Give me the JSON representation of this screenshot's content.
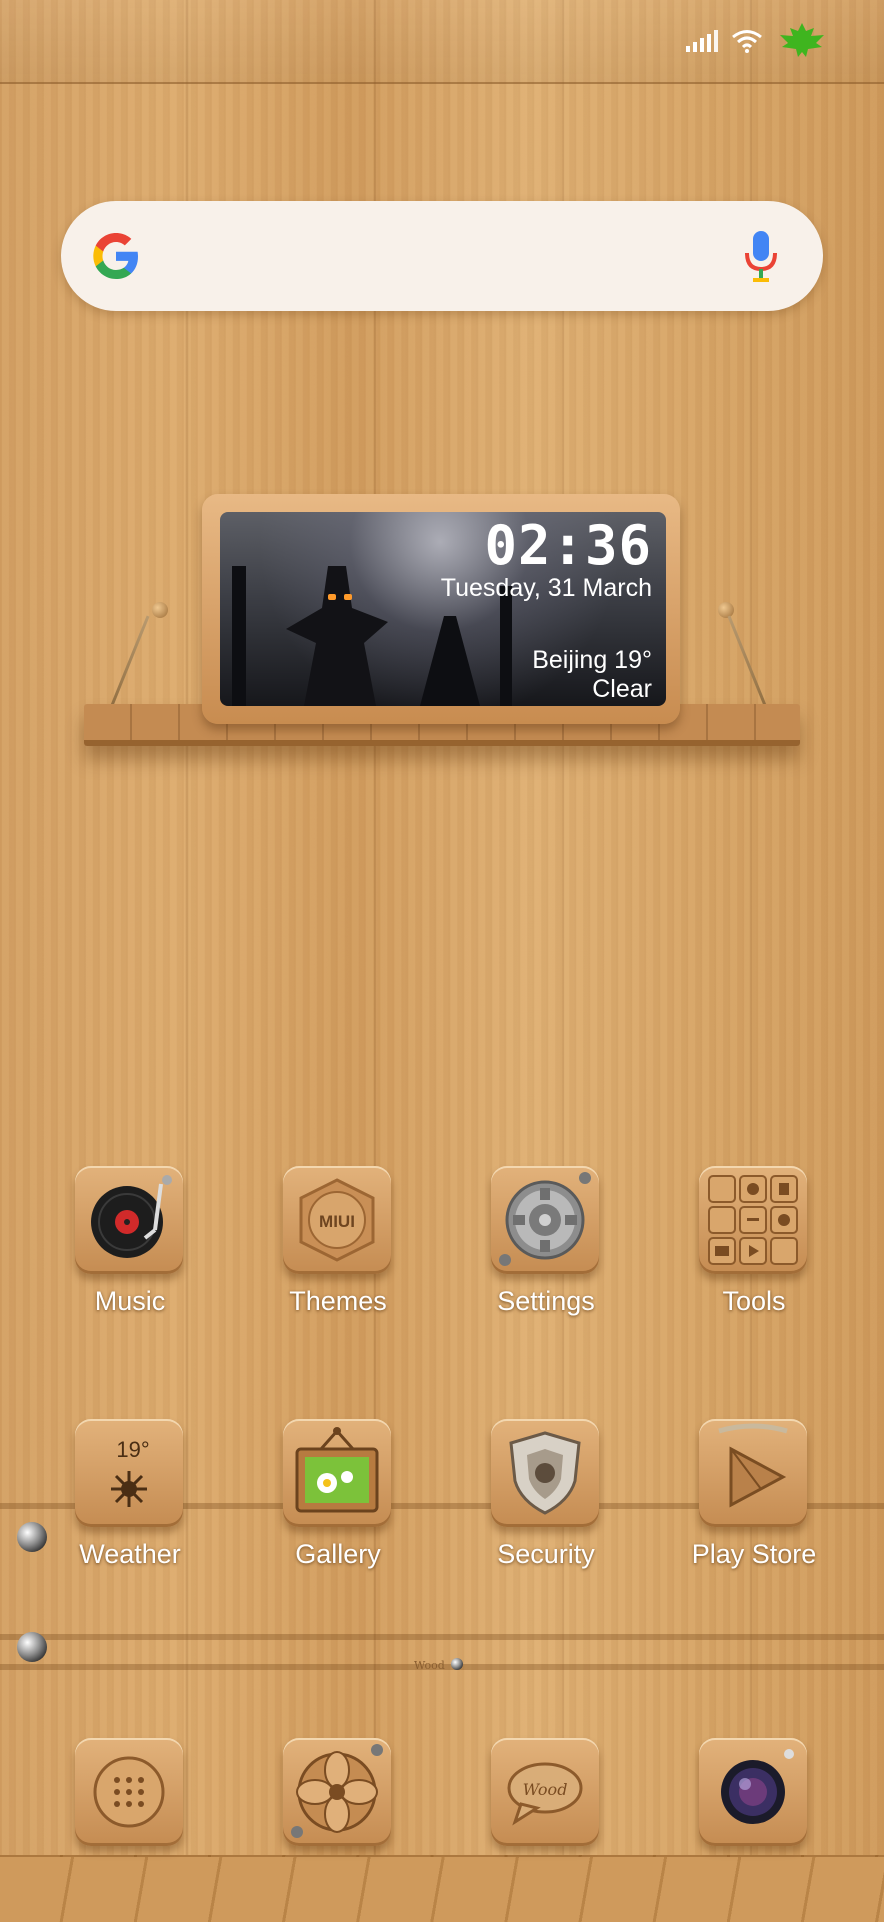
{
  "status_bar": {
    "icons": [
      "signal-icon",
      "wifi-icon",
      "leaf-battery-icon"
    ]
  },
  "search": {
    "logo": "google-g-icon",
    "mic": "mic-icon"
  },
  "widget": {
    "time": "02:36",
    "date": "Tuesday, 31 March",
    "city_temp": "Beijing  19°",
    "condition": "Clear"
  },
  "apps_row1": [
    {
      "label": "Music",
      "icon": "turntable-icon"
    },
    {
      "label": "Themes",
      "icon": "miui-badge-icon"
    },
    {
      "label": "Settings",
      "icon": "gear-icon"
    },
    {
      "label": "Tools",
      "icon": "tools-folder-icon"
    }
  ],
  "apps_row2": [
    {
      "label": "Weather",
      "icon": "sun-icon",
      "temp": "19°"
    },
    {
      "label": "Gallery",
      "icon": "picture-frame-icon"
    },
    {
      "label": "Security",
      "icon": "shield-icon"
    },
    {
      "label": "Play Store",
      "icon": "play-icon"
    }
  ],
  "tile_text": {
    "miui": "MIUI",
    "weather_temp": "19°",
    "wood": "Wood",
    "message_wood": "Wood"
  },
  "dock": [
    {
      "icon": "phone-dial-icon"
    },
    {
      "icon": "fan-icon"
    },
    {
      "icon": "message-bubble-icon"
    },
    {
      "icon": "camera-lens-icon"
    }
  ],
  "colors": {
    "wood_base": "#d6a466",
    "label_text": "#ffffff",
    "leaf_green": "#3fb51f"
  }
}
